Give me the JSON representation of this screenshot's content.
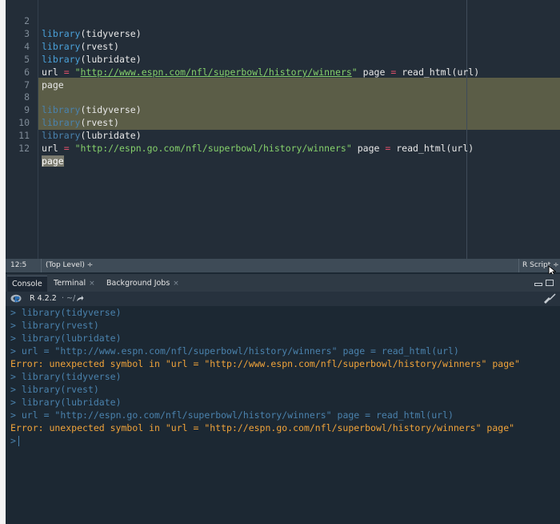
{
  "editor": {
    "lines": [
      {
        "n": "2",
        "fn": "library",
        "arg": "tidyverse"
      },
      {
        "n": "3",
        "fn": "library",
        "arg": "rvest"
      },
      {
        "n": "4",
        "fn": "library",
        "arg": "lubridate"
      },
      {
        "n": "5",
        "var": "url",
        "op": "=",
        "url_q1": "\"",
        "url": "http://www.espn.com/nfl/superbowl/history/winners",
        "url_q2": "\"",
        "rest_var": "page",
        "op2": "=",
        "call": "read_html",
        "call_arg": "url"
      },
      {
        "n": "6",
        "var": "page"
      },
      {
        "n": "7"
      },
      {
        "n": "8",
        "fn": "library",
        "arg": "tidyverse"
      },
      {
        "n": "9",
        "fn": "library",
        "arg": "rvest"
      },
      {
        "n": "10",
        "fn": "library",
        "arg": "lubridate"
      },
      {
        "n": "11",
        "var": "url",
        "op": "=",
        "url_str": "\"http://espn.go.com/nfl/superbowl/history/winners\"",
        "rest_var": "page",
        "op2": "=",
        "call": "read_html",
        "call_arg": "url"
      },
      {
        "n": "12",
        "var": "page"
      }
    ]
  },
  "statusbar": {
    "position": "12:5",
    "scope": "(Top Level) ÷",
    "file_type": "R Script ÷"
  },
  "tabs": {
    "console": "Console",
    "terminal": "Terminal",
    "jobs": "Background Jobs",
    "close": "×"
  },
  "console_header": {
    "version": "R 4.2.2",
    "path": "· ~/",
    "icons": [
      "r-logo",
      "arrow-icon",
      "broom-icon"
    ]
  },
  "console": {
    "prompt": ">",
    "lines": [
      {
        "type": "echo",
        "text": "library(tidyverse)"
      },
      {
        "type": "echo",
        "text": "library(rvest)"
      },
      {
        "type": "echo",
        "text": "library(lubridate)"
      },
      {
        "type": "echo",
        "text": "url = \"http://www.espn.com/nfl/superbowl/history/winners\" page = read_html(url)"
      },
      {
        "type": "error",
        "text": "Error: unexpected symbol in \"url = \"http://www.espn.com/nfl/superbowl/history/winners\" page\""
      },
      {
        "type": "echo",
        "text": "library(tidyverse)"
      },
      {
        "type": "echo",
        "text": "library(rvest)"
      },
      {
        "type": "echo",
        "text": "library(lubridate)"
      },
      {
        "type": "echo",
        "text": "url = \"http://espn.go.com/nfl/superbowl/history/winners\" page = read_html(url)"
      },
      {
        "type": "error",
        "text": "Error: unexpected symbol in \"url = \"http://espn.go.com/nfl/superbowl/history/winners\" page\""
      }
    ]
  },
  "colors": {
    "editor_bg": "#232d38",
    "selection": "#5b5d47",
    "function": "#4aa0d8",
    "string": "#85d06b",
    "operator": "#e0506a",
    "error": "#f0a33a"
  }
}
